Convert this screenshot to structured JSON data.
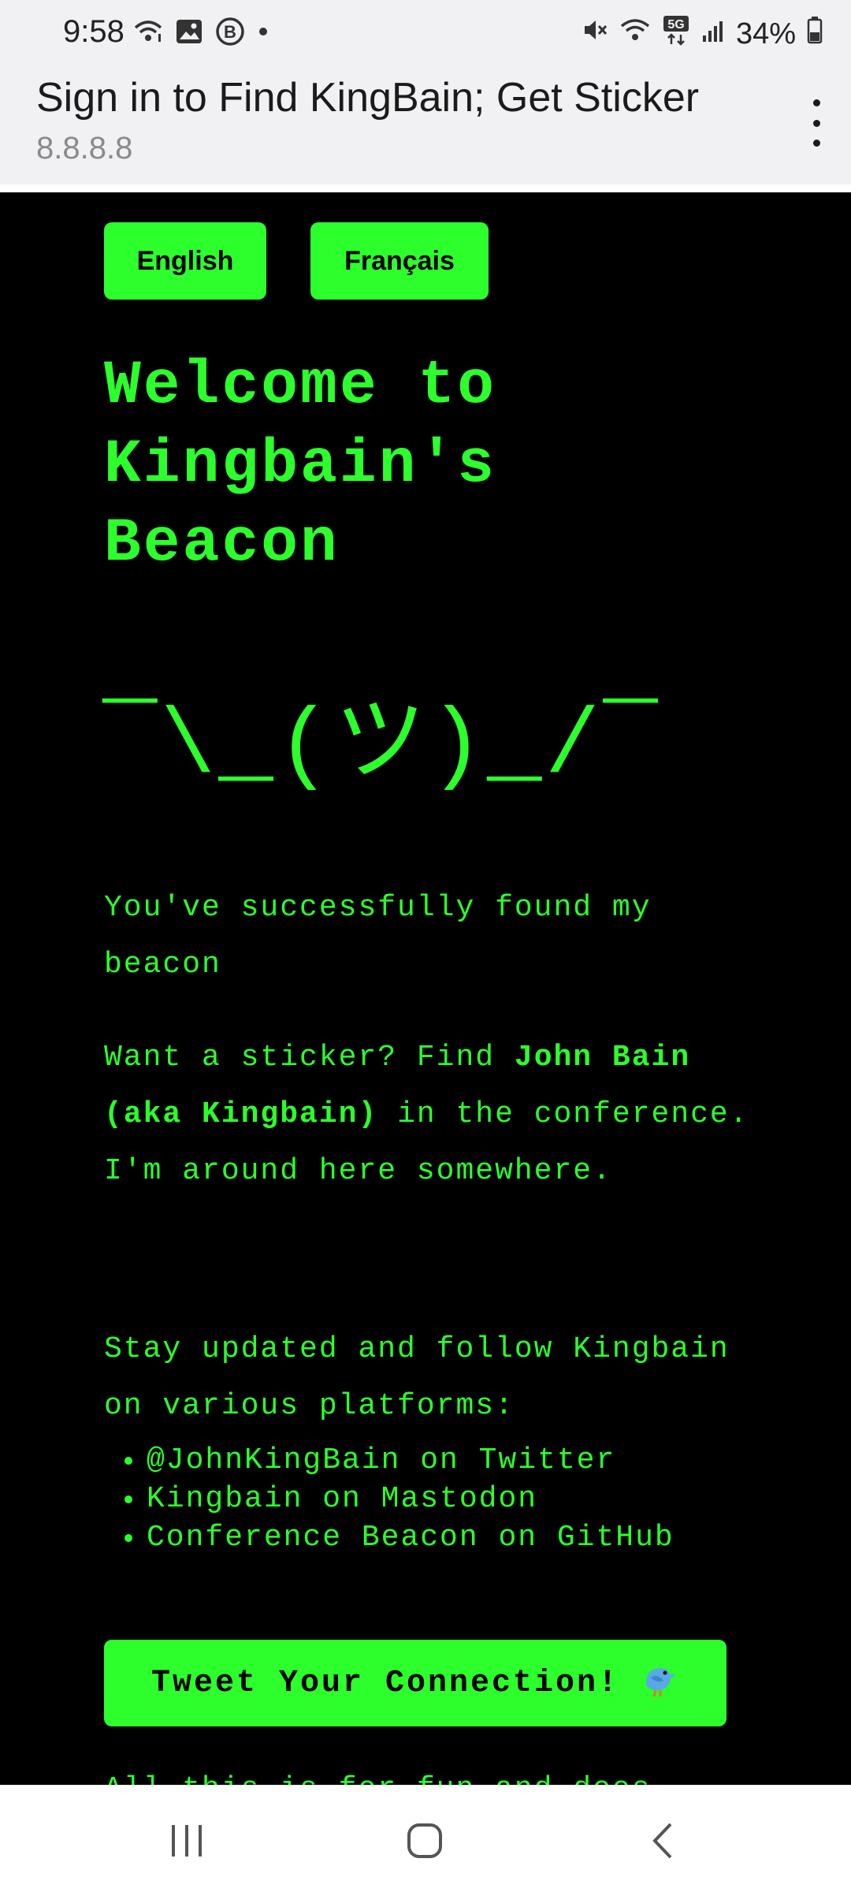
{
  "status_bar": {
    "time": "9:58",
    "battery": "34%",
    "network": "5G"
  },
  "browser": {
    "title": "Sign in to Find KingBain; Get Sticker",
    "url": "8.8.8.8"
  },
  "languages": [
    "English",
    "Français"
  ],
  "welcome_heading": "Welcome to Kingbain's Beacon",
  "shrug": "¯\\_(ツ)_/¯",
  "paragraphs": {
    "found": "You've successfully found my beacon",
    "sticker_prefix": "Want a sticker? Find ",
    "sticker_name": "John Bain (aka Kingbain)",
    "sticker_suffix": " in the conference. I'm around here somewhere.",
    "follow": "Stay updated and follow Kingbain on various platforms:"
  },
  "platforms": [
    "@JohnKingBain on Twitter",
    "Kingbain on Mastodon",
    "Conference Beacon on GitHub"
  ],
  "tweet_button": "Tweet Your Connection!",
  "cutoff_text": "All this is for fun and does",
  "colors": {
    "accent": "#2cff2c",
    "background": "#000000",
    "chrome": "#f1f1f3"
  },
  "icons": {
    "wifi": "wifi-icon",
    "gallery": "gallery-icon",
    "b_app": "b-app-icon",
    "mute": "mute-icon",
    "signal": "signal-icon",
    "battery": "battery-icon",
    "menu": "more-vert-icon",
    "bird": "bird-icon"
  }
}
